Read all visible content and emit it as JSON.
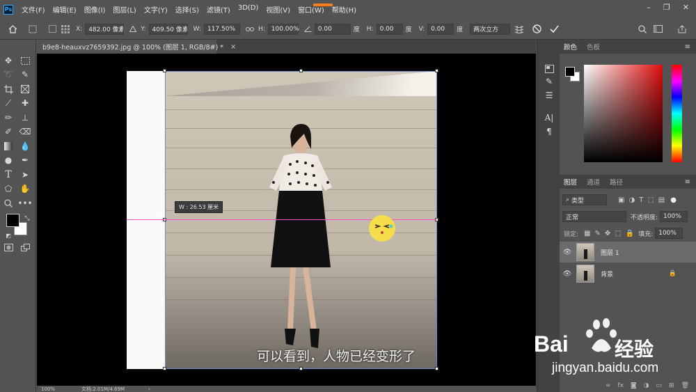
{
  "app": {
    "logo_text": "Ps"
  },
  "menu": [
    "文件(F)",
    "编辑(E)",
    "图像(I)",
    "图层(L)",
    "文字(Y)",
    "选择(S)",
    "滤镜(T)",
    "3D(D)",
    "视图(V)",
    "窗口(W)",
    "帮助(H)"
  ],
  "window_controls": {
    "minimize": "–",
    "restore": "❐",
    "close": "✕"
  },
  "options": {
    "x_label": "X:",
    "x_value": "482.00 像素",
    "y_label": "Y:",
    "y_value": "409.50 像素",
    "w_label": "W:",
    "w_value": "117.50%",
    "h_label": "H:",
    "h_value": "100.00%",
    "angle_value": "0.00",
    "angle_unit": "度",
    "hskew_label": "H:",
    "hskew_value": "0.00",
    "hskew_unit": "度",
    "vskew_label": "V:",
    "vskew_value": "0.00",
    "vskew_unit": "度",
    "interpolation": "两次立方"
  },
  "document": {
    "tab_title": "b9e8-heauxvz7659392.jpg @ 100% (图层 1, RGB/8#) *",
    "tab_close": "×",
    "tooltip": "W : 26.53 厘米",
    "subtitle": "可以看到，人物已经变形了"
  },
  "status": {
    "zoom": "100%",
    "doc_size": "文档:2.01M/4.69M"
  },
  "color_panel": {
    "tabs": [
      "颜色",
      "色板"
    ],
    "fg_color": "#000000",
    "bg_color": "#ffffff"
  },
  "layers_panel": {
    "tabs": [
      "图层",
      "通道",
      "路径"
    ],
    "filter_kind": "类型",
    "blend_mode": "正常",
    "opacity_label": "不透明度:",
    "opacity_value": "100%",
    "lock_label": "锁定:",
    "fill_label": "填充:",
    "fill_value": "100%",
    "layers": [
      {
        "name": "图层 1",
        "selected": true,
        "locked": false
      },
      {
        "name": "背景",
        "selected": false,
        "locked": true
      }
    ]
  },
  "watermark": {
    "brand_latin": "Bai",
    "brand_cn": "经验",
    "url": "jingyan.baidu.com"
  },
  "colors": {
    "guide": "#ff52c7",
    "bbox": "#6b8bd6",
    "accent": "#31a8ff"
  }
}
